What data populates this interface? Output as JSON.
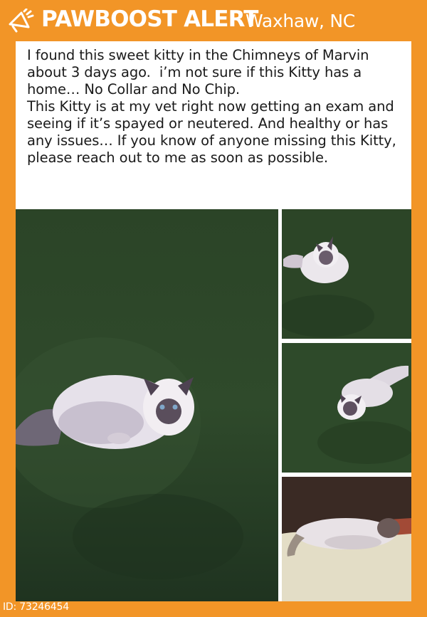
{
  "header": {
    "brand": "PAWBOOST ALERT",
    "location": "Waxhaw, NC",
    "icon": "megaphone-icon",
    "bg_color": "#f29527",
    "text_color": "#ffffff"
  },
  "post": {
    "description": "I found this sweet kitty in the Chimneys of Marvin about 3 days ago.  i’m not sure if this Kitty has a home… No Collar and No Chip.\nThis Kitty is at my vet right now getting an exam and seeing if it’s spayed or neutered. And healthy or has any issues… If you know of anyone missing this Kitty, please reach out to me as soon as possible."
  },
  "footer": {
    "id_text": "ID: 73246454"
  }
}
